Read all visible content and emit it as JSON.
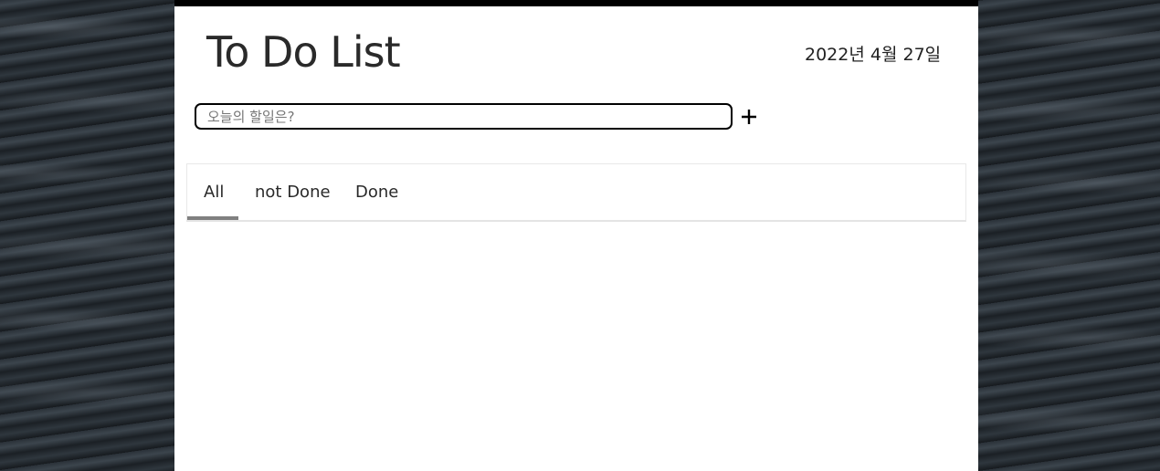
{
  "app": {
    "title": "To Do List",
    "date": "2022년 4월 27일"
  },
  "input": {
    "placeholder": "오늘의 할일은?",
    "value": "",
    "add_icon": "plus-icon"
  },
  "tabs": [
    {
      "label": "All",
      "active": true
    },
    {
      "label": "not Done",
      "active": false
    },
    {
      "label": "Done",
      "active": false
    }
  ],
  "colors": {
    "panel": "#ffffff",
    "title_text": "#2a2a2a",
    "tab_underline": "#808080"
  }
}
